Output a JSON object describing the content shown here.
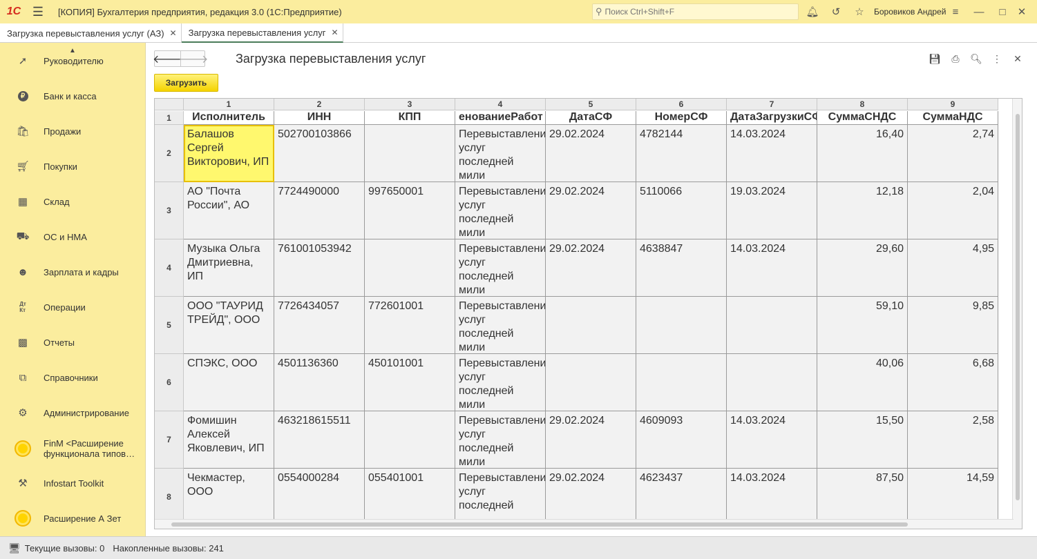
{
  "window": {
    "logo": "1С",
    "title": "[КОПИЯ] Бухгалтерия предприятия, редакция 3.0  (1С:Предприятие)",
    "search_placeholder": "Поиск Ctrl+Shift+F",
    "user": "Боровиков Андрей"
  },
  "tabs": [
    {
      "label": "Загрузка перевыставления услуг (АЗ)"
    },
    {
      "label": "Загрузка перевыставления услуг"
    }
  ],
  "sidebar": {
    "items": [
      {
        "label": "Руководителю",
        "icon": "chart-icon"
      },
      {
        "label": "Банк и касса",
        "icon": "ruble-icon"
      },
      {
        "label": "Продажи",
        "icon": "bag-icon"
      },
      {
        "label": "Покупки",
        "icon": "cart-icon"
      },
      {
        "label": "Склад",
        "icon": "grid-icon"
      },
      {
        "label": "ОС и НМА",
        "icon": "truck-icon"
      },
      {
        "label": "Зарплата и кадры",
        "icon": "person-icon"
      },
      {
        "label": "Операции",
        "icon": "dt-kt-icon"
      },
      {
        "label": "Отчеты",
        "icon": "bars-icon"
      },
      {
        "label": "Справочники",
        "icon": "books-icon"
      },
      {
        "label": "Администрирование",
        "icon": "gear-icon"
      },
      {
        "label": "FinM <Расширение функционала типов…",
        "icon": "coin-icon"
      },
      {
        "label": "Infostart Toolkit",
        "icon": "tools-icon"
      },
      {
        "label": "Расширение А Зет",
        "icon": "coin-icon"
      }
    ]
  },
  "form": {
    "title": "Загрузка перевыставления услуг",
    "load_button": "Загрузить"
  },
  "sheet": {
    "column_numbers": [
      "1",
      "2",
      "3",
      "4",
      "5",
      "6",
      "7",
      "8",
      "9"
    ],
    "row_numbers": [
      "1",
      "2",
      "3",
      "4",
      "5",
      "6",
      "7",
      "8"
    ],
    "headers": [
      "Исполнитель",
      "ИНН",
      "КПП",
      "енованиеРабот",
      "ДатаСФ",
      "НомерСФ",
      "ДатаЗагрузкиСФ",
      "СуммаСНДС",
      "СуммаНДС"
    ],
    "rows": [
      [
        "Балашов Сергей Викторович, ИП",
        "502700103866",
        "",
        "Перевыставление услуг последней мили",
        "29.02.2024",
        "4782144",
        "14.03.2024",
        "16,40",
        "2,74"
      ],
      [
        "АО \"Почта России\", АО",
        "7724490000",
        "997650001",
        "Перевыставление услуг последней мили",
        "29.02.2024",
        "5110066",
        "19.03.2024",
        "12,18",
        "2,04"
      ],
      [
        "Музыка Ольга Дмитриевна, ИП",
        "761001053942",
        "",
        "Перевыставление услуг последней мили",
        "29.02.2024",
        "4638847",
        "14.03.2024",
        "29,60",
        "4,95"
      ],
      [
        "ООО \"ТАУРИД ТРЕЙД\", ООО",
        "7726434057",
        "772601001",
        "Перевыставление услуг последней мили",
        "",
        "",
        "",
        "59,10",
        "9,85"
      ],
      [
        "СПЭКС, ООО",
        "4501136360",
        "450101001",
        "Перевыставление услуг последней мили",
        "",
        "",
        "",
        "40,06",
        "6,68"
      ],
      [
        "Фомишин Алексей Яковлевич, ИП",
        "463218615511",
        "",
        "Перевыставление услуг последней мили",
        "29.02.2024",
        "4609093",
        "14.03.2024",
        "15,50",
        "2,58"
      ],
      [
        "Чекмастер, ООО",
        "0554000284",
        "055401001",
        "Перевыставление услуг последней",
        "29.02.2024",
        "4623437",
        "14.03.2024",
        "87,50",
        "14,59"
      ]
    ]
  },
  "status": {
    "current_calls": "Текущие вызовы: 0",
    "accumulated_calls": "Накопленные вызовы: 241"
  }
}
